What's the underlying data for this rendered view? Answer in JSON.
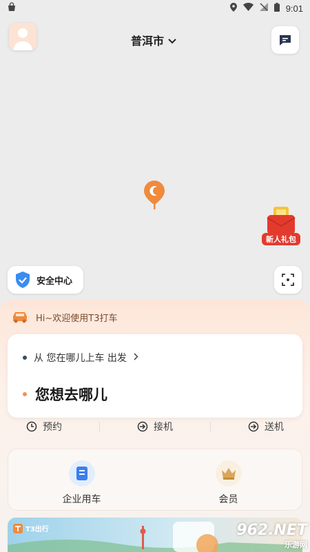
{
  "status_bar": {
    "time": "9:01"
  },
  "header": {
    "city": "普洱市"
  },
  "map": {
    "gift_label": "新人礼包",
    "safety_center": "安全中心"
  },
  "sheet": {
    "welcome": "Hi~欢迎使用T3打车",
    "pickup_text": "从 您在哪儿上车 出发",
    "destination_prompt": "您想去哪儿",
    "modes": [
      {
        "label": "预约"
      },
      {
        "label": "接机"
      },
      {
        "label": "送机"
      }
    ],
    "services": [
      {
        "label": "企业用车"
      },
      {
        "label": "会员"
      }
    ]
  },
  "banner": {
    "logo_text": "T3出行"
  },
  "watermark": {
    "top": "962.NET",
    "bottom": "乐游网"
  },
  "colors": {
    "accent_orange": "#f08a3c",
    "pickup_dot": "#3a4a6b",
    "dest_dot": "#f0934d",
    "shield_blue": "#3b8cf0"
  }
}
